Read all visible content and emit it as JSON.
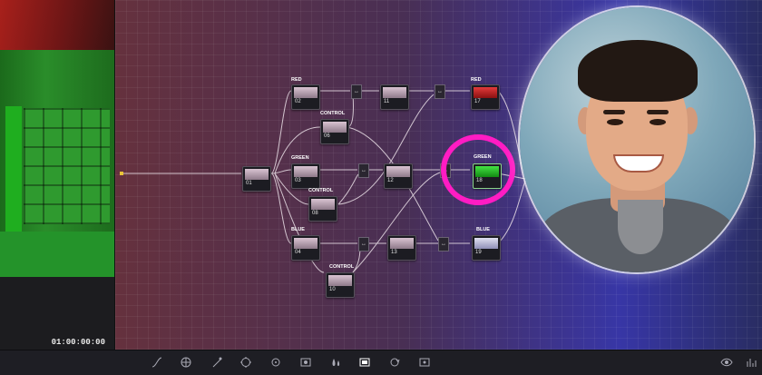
{
  "viewer": {
    "timecode": "01:00:00:00"
  },
  "nodes": [
    {
      "id": "n01",
      "num": "01",
      "label": ""
    },
    {
      "id": "n02",
      "num": "02",
      "label": "RED"
    },
    {
      "id": "n03",
      "num": "03",
      "label": "GREEN"
    },
    {
      "id": "n04",
      "num": "04",
      "label": "BLUE"
    },
    {
      "id": "n06",
      "num": "06",
      "label": "CONTROL"
    },
    {
      "id": "n08",
      "num": "08",
      "label": "CONTROL"
    },
    {
      "id": "n10",
      "num": "10",
      "label": "CONTROL"
    },
    {
      "id": "n11",
      "num": "11",
      "label": ""
    },
    {
      "id": "n12",
      "num": "12",
      "label": ""
    },
    {
      "id": "n13",
      "num": "13",
      "label": ""
    },
    {
      "id": "n17",
      "num": "17",
      "label": "RED"
    },
    {
      "id": "n18",
      "num": "18",
      "label": "GREEN"
    },
    {
      "id": "n19",
      "num": "19",
      "label": "BLUE"
    }
  ],
  "toolbar": {
    "icons": [
      "curves-icon",
      "color-warper-icon",
      "qualifier-icon",
      "window-icon",
      "tracker-icon",
      "magic-mask-icon",
      "blur-icon",
      "key-icon",
      "sizing-icon",
      "stereo-icon",
      "eye-icon",
      "scopes-icon"
    ]
  },
  "colors": {
    "highlight": "#ff1cc3",
    "green_node": "#2fcf2f",
    "red_node": "#d42a2a"
  }
}
